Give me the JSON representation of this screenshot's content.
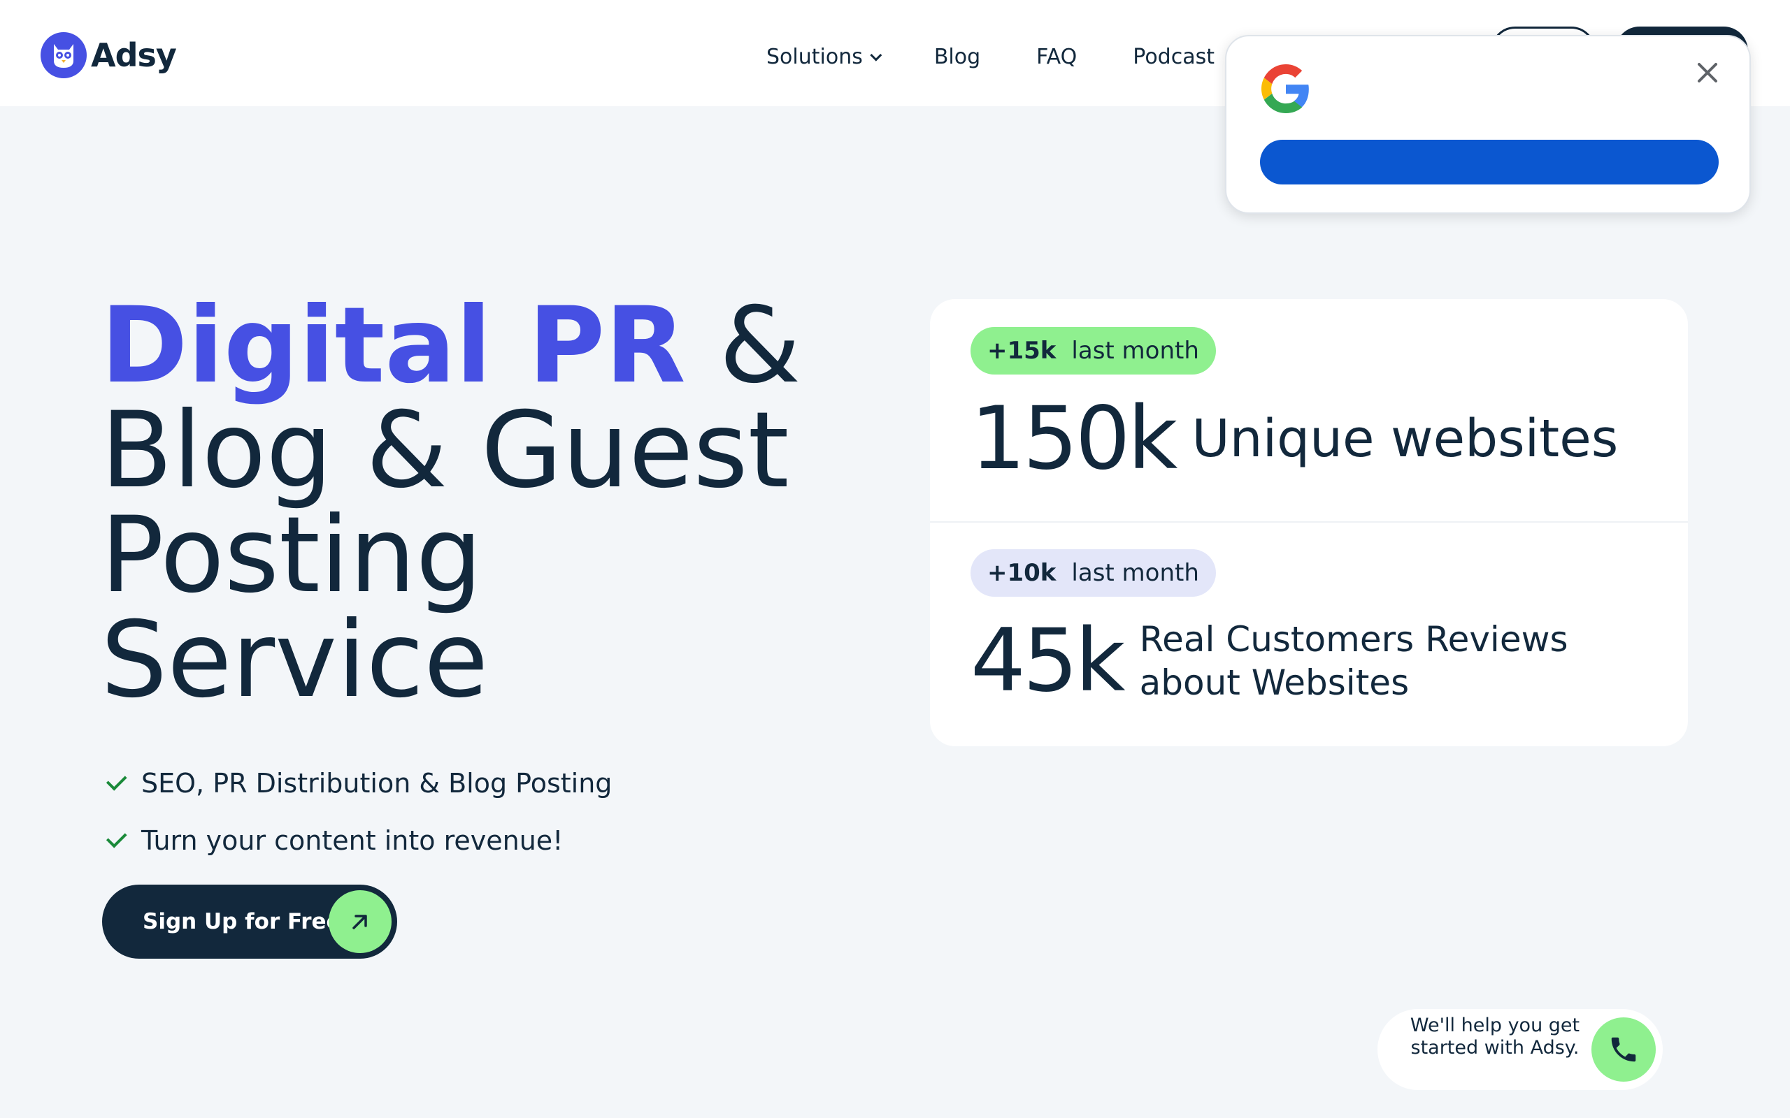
{
  "header": {
    "logo_text": "Adsy",
    "nav": [
      {
        "label": "Solutions",
        "has_dropdown": true
      },
      {
        "label": "Blog"
      },
      {
        "label": "FAQ"
      },
      {
        "label": "Podcast"
      }
    ]
  },
  "google_popup": {
    "icon": "google-g-icon",
    "close_icon": "close-icon",
    "button_color": "#0b57d0"
  },
  "hero": {
    "title_accent": "Digital PR",
    "title_amp": " &",
    "title_line2": "Blog & Guest",
    "title_line3": "Posting",
    "title_line4": "Service",
    "benefits": [
      "SEO, PR Distribution & Blog Posting",
      "Turn your content into revenue!"
    ],
    "cta_label": "Sign Up for Free"
  },
  "stats": [
    {
      "badge_value": "+15k",
      "badge_text": "last month",
      "value": "150k",
      "label": "Unique websites",
      "badge_color": "#8ff08f"
    },
    {
      "badge_value": "+10k",
      "badge_text": "last month",
      "value": "45k",
      "label": "Real Customers Reviews about Websites",
      "badge_color": "#e3e6f9"
    }
  ],
  "chat": {
    "text": "We'll help you get started with Adsy.",
    "icon": "phone-icon"
  },
  "colors": {
    "accent": "#4650e3",
    "dark": "#12283c",
    "green": "#8ff08f",
    "background": "#f3f6f9"
  }
}
